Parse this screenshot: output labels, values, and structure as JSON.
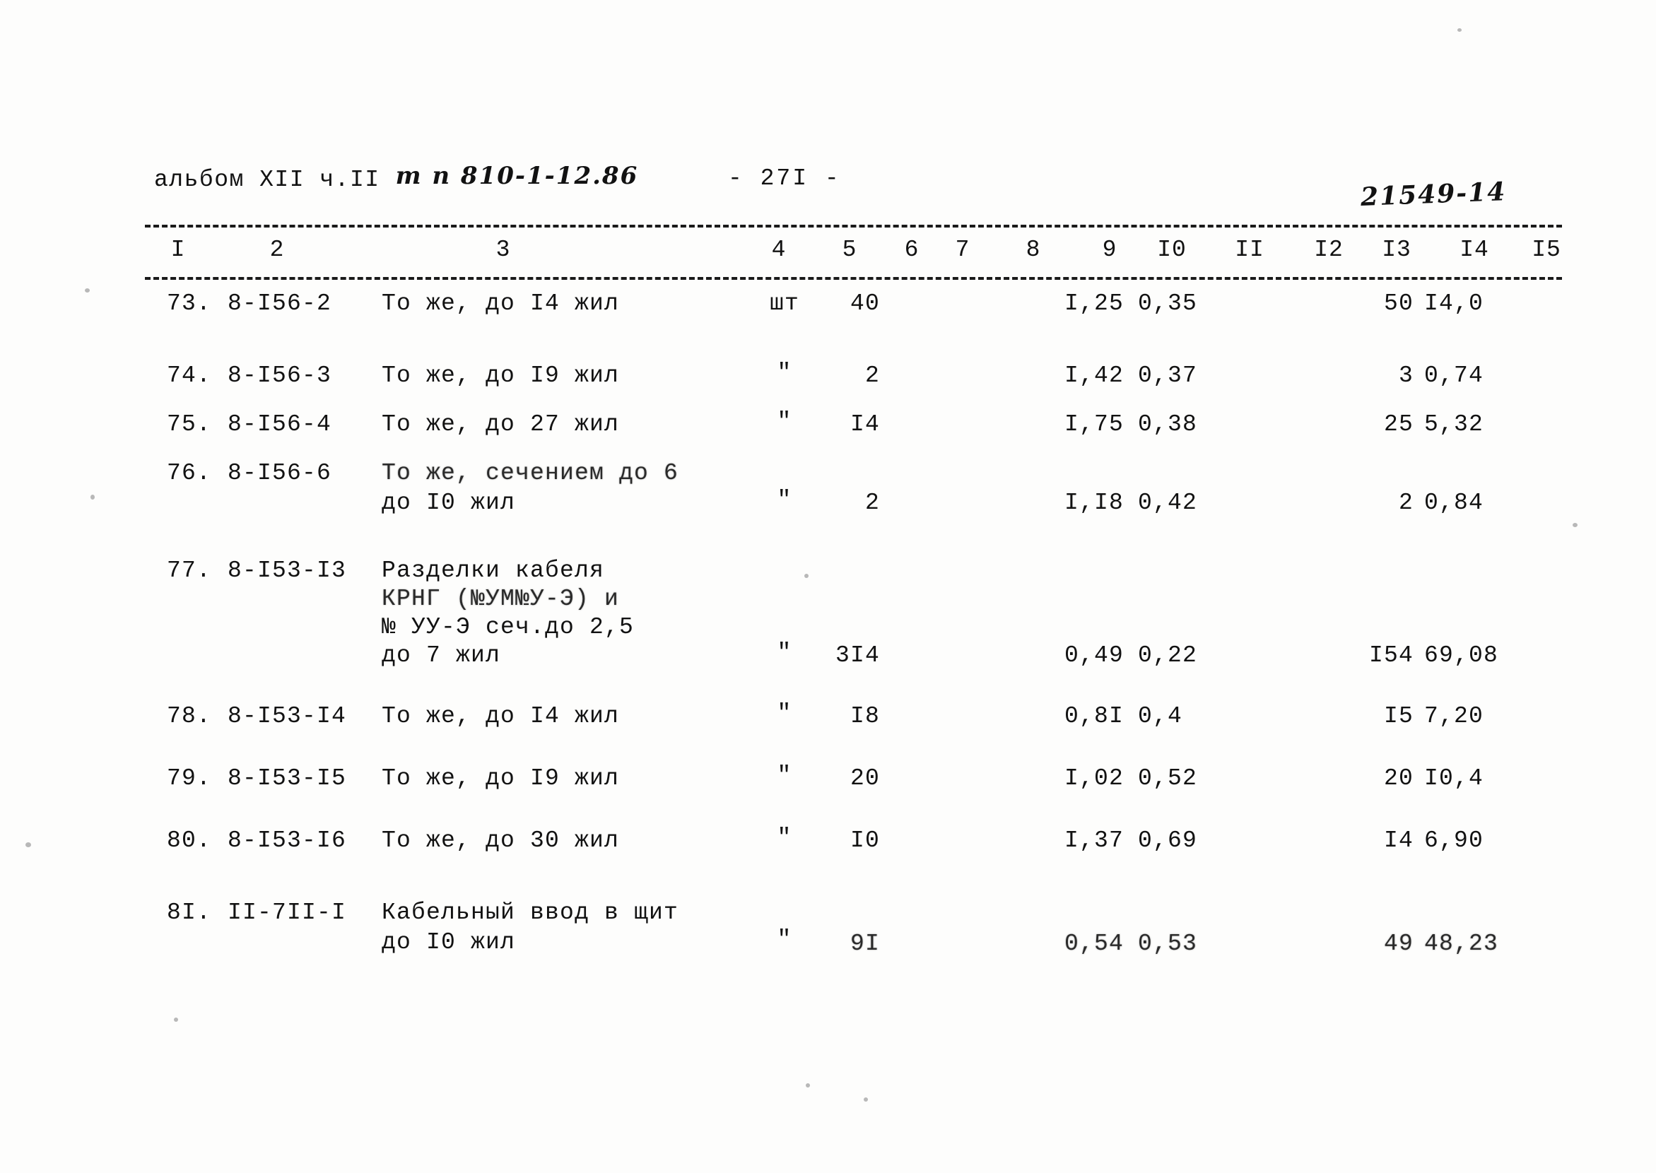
{
  "document": {
    "header": {
      "album_typed": "альбом XII ч.II",
      "album_handwritten": "т п 810-1-12.86",
      "page_number": "- 27I -",
      "archive_number": "21549-14"
    },
    "column_headers": [
      "I",
      "2",
      "3",
      "4",
      "5",
      "6",
      "7",
      "8",
      "9",
      "I0",
      "II",
      "I2",
      "I3",
      "I4",
      "I5"
    ],
    "rows": [
      {
        "num": "73.",
        "code": "8-I56-2",
        "desc": [
          "То же, до I4 жил"
        ],
        "unit": "шт",
        "qty": "40",
        "c9": "I,25",
        "c10": "0,35",
        "c13": "50",
        "c14": "I4,0"
      },
      {
        "num": "74.",
        "code": "8-I56-3",
        "desc": [
          "То же, до I9 жил"
        ],
        "unit": "\"",
        "qty": "2",
        "c9": "I,42",
        "c10": "0,37",
        "c13": "3",
        "c14": "0,74"
      },
      {
        "num": "75.",
        "code": "8-I56-4",
        "desc": [
          "То же, до 27 жил"
        ],
        "unit": "\"",
        "qty": "I4",
        "c9": "I,75",
        "c10": "0,38",
        "c13": "25",
        "c14": "5,32"
      },
      {
        "num": "76.",
        "code": "8-I56-6",
        "desc": [
          "То же, сечением до 6",
          "до I0 жил"
        ],
        "unit": "\"",
        "qty": "2",
        "c9": "I,I8",
        "c10": "0,42",
        "c13": "2",
        "c14": "0,84"
      },
      {
        "num": "77.",
        "code": "8-I53-I3",
        "desc": [
          "Разделки кабеля",
          "КРНГ (№УМ№У-Э) и",
          "№ УУ-Э сеч.до 2,5",
          "до 7 жил"
        ],
        "unit": "\"",
        "qty": "3I4",
        "c9": "0,49",
        "c10": "0,22",
        "c13": "I54",
        "c14": "69,08"
      },
      {
        "num": "78.",
        "code": "8-I53-I4",
        "desc": [
          "То же, до I4 жил"
        ],
        "unit": "\"",
        "qty": "I8",
        "c9": "0,8I",
        "c10": "0,4",
        "c13": "I5",
        "c14": "7,20"
      },
      {
        "num": "79.",
        "code": "8-I53-I5",
        "desc": [
          "То же, до I9 жил"
        ],
        "unit": "\"",
        "qty": "20",
        "c9": "I,02",
        "c10": "0,52",
        "c13": "20",
        "c14": "I0,4"
      },
      {
        "num": "80.",
        "code": "8-I53-I6",
        "desc": [
          "То же, до 30 жил"
        ],
        "unit": "\"",
        "qty": "I0",
        "c9": "I,37",
        "c10": "0,69",
        "c13": "I4",
        "c14": "6,90"
      },
      {
        "num": "8I.",
        "code": "II-7II-I",
        "desc": [
          "Кабельный ввод в щит",
          "до I0 жил"
        ],
        "unit": "\"",
        "qty": "9I",
        "c9": "0,54",
        "c10": "0,53",
        "c13": "49",
        "c14": "48,23"
      }
    ]
  }
}
